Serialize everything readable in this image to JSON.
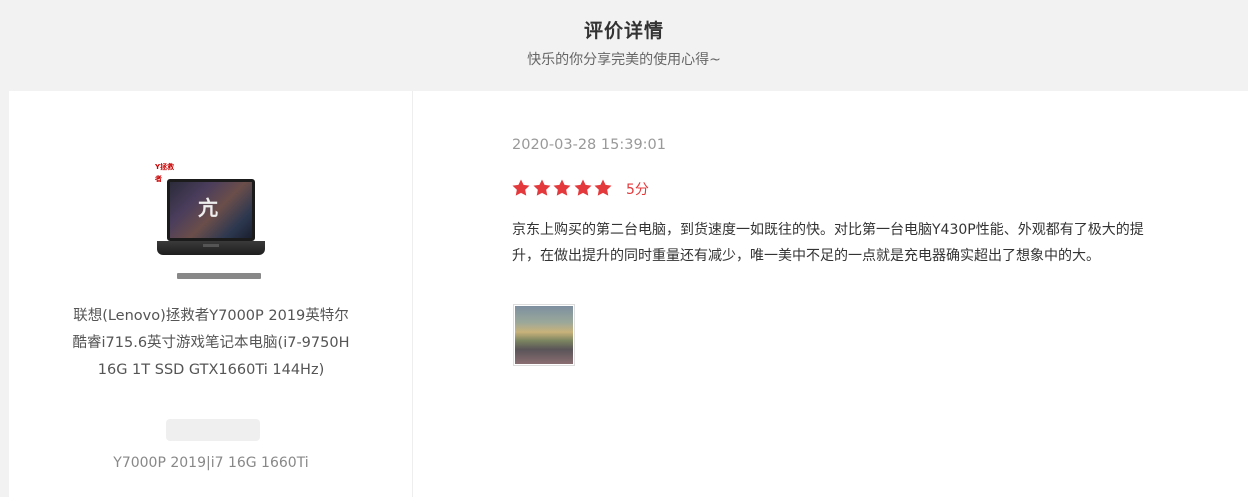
{
  "header": {
    "title": "评价详情",
    "subtitle": "快乐的你分享完美的使用心得~"
  },
  "product": {
    "image_icon": "laptop-product-image",
    "logo_text": "Y拯救者",
    "screen_glyph": "亢",
    "name": "联想(Lenovo)拯救者Y7000P 2019英特尔酷睿i715.6英寸游戏笔记本电脑(i7-9750H 16G 1T SSD GTX1660Ti 144Hz)",
    "spec": "Y7000P 2019|i7 16G 1660Ti"
  },
  "review": {
    "date": "2020-03-28 15:39:01",
    "rating": 5,
    "score_label": "5分",
    "star_icon": "star-icon",
    "star_color": "#e4393c",
    "text": "京东上购买的第二台电脑，到货速度一如既往的快。对比第一台电脑Y430P性能、外观都有了极大的提升，在做出提升的同时重量还有减少，唯一美中不足的一点就是充电器确实超出了想象中的大。",
    "photos": [
      "review-photo-thumbnail"
    ]
  }
}
